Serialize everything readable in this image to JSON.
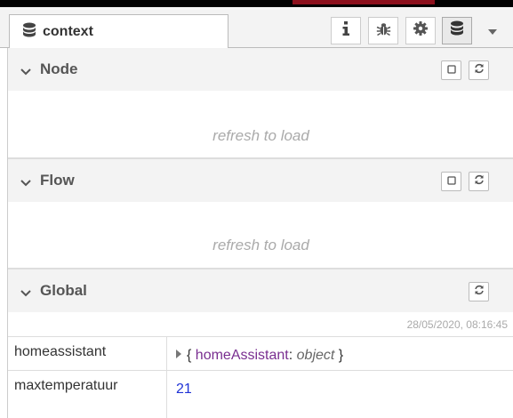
{
  "tab": {
    "label": "context"
  },
  "toolbar": {
    "icons": [
      "info-icon",
      "bug-icon",
      "gear-icon",
      "database-icon"
    ]
  },
  "sections": [
    {
      "title": "Node",
      "placeholder": "refresh to load"
    },
    {
      "title": "Flow",
      "placeholder": "refresh to load"
    },
    {
      "title": "Global",
      "timestamp": "28/05/2020, 08:16:45"
    }
  ],
  "global_rows": [
    {
      "key": "homeassistant",
      "open_brace": "{",
      "obj_key": "homeAssistant",
      "sep": ":",
      "obj_type": "object",
      "close_brace": "}"
    },
    {
      "key": "maxtemperatuur",
      "value": "21"
    }
  ]
}
